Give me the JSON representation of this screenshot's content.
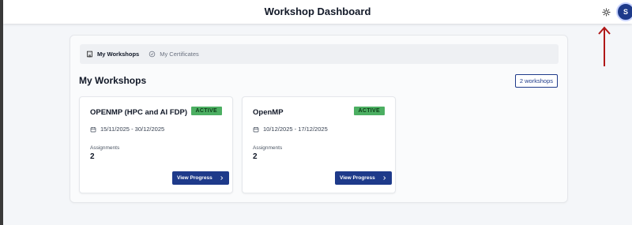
{
  "header": {
    "title": "Workshop Dashboard",
    "avatar_initial": "S"
  },
  "tabs": [
    {
      "label": "My Workshops",
      "active": true,
      "icon": "building-icon"
    },
    {
      "label": "My Certificates",
      "active": false,
      "icon": "check-circle-icon"
    }
  ],
  "section": {
    "title": "My Workshops",
    "count_label": "2 workshops"
  },
  "workshops": [
    {
      "title": "OPENMP (HPC and AI FDP)",
      "status": "ACTIVE",
      "dates": "15/11/2025 - 30/12/2025",
      "assignments_label": "Assignments",
      "assignments_count": "2",
      "button_label": "View Progress"
    },
    {
      "title": "OpenMP",
      "status": "ACTIVE",
      "dates": "10/12/2025 - 17/12/2025",
      "assignments_label": "Assignments",
      "assignments_count": "2",
      "button_label": "View Progress"
    }
  ],
  "colors": {
    "primary": "#1e3a8a",
    "status_active": "#4caf62",
    "annotation": "#b01818"
  }
}
